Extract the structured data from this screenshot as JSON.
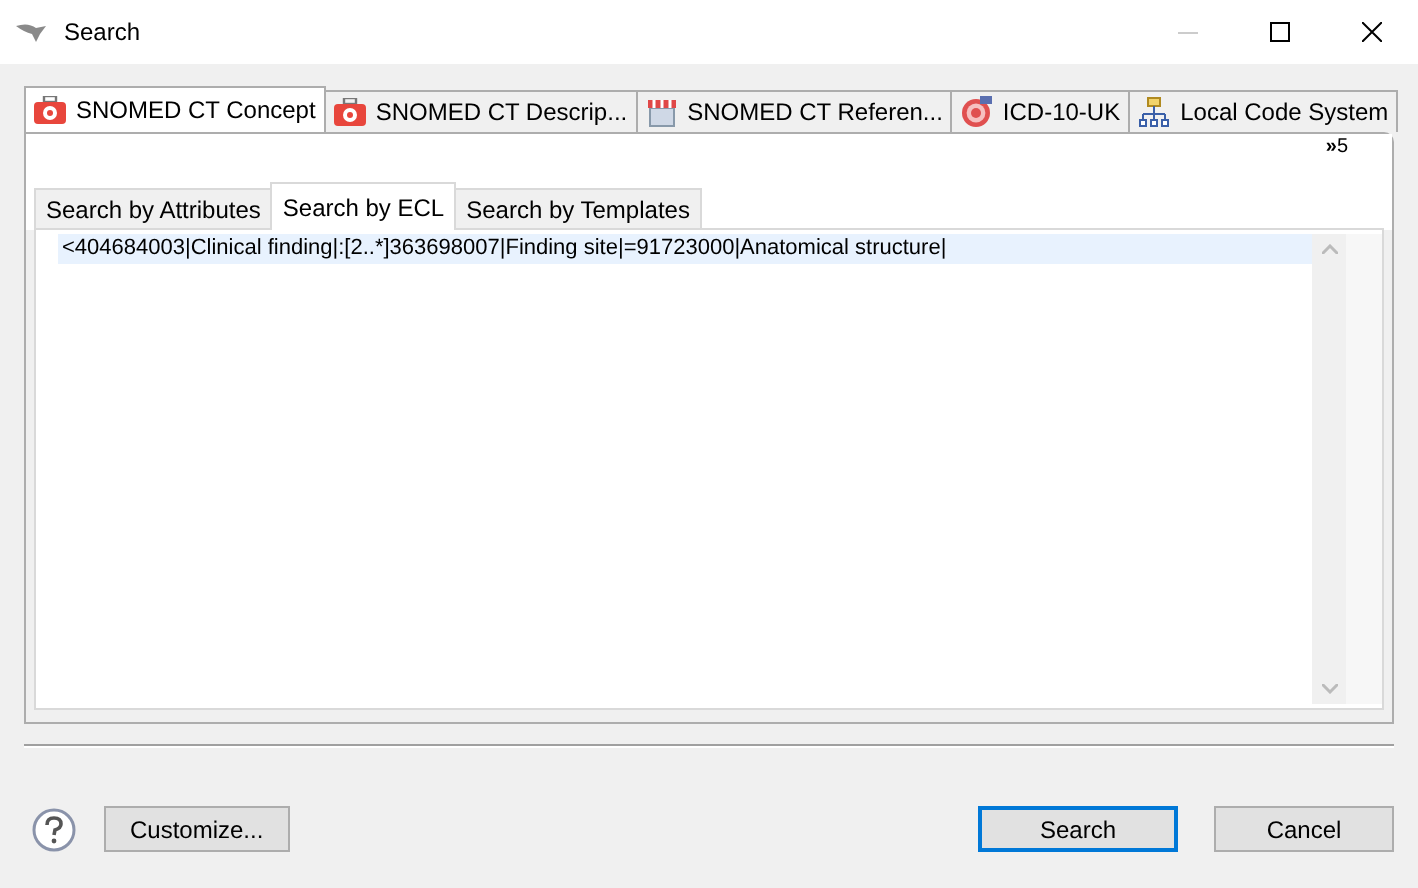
{
  "window": {
    "title": "Search"
  },
  "tabs": [
    {
      "label": "SNOMED CT Concept",
      "kind": "kit",
      "selected": true
    },
    {
      "label": "SNOMED CT Descrip...",
      "kind": "kit",
      "selected": false
    },
    {
      "label": "SNOMED CT Referen...",
      "kind": "shop",
      "selected": false
    },
    {
      "label": "ICD-10-UK",
      "kind": "target",
      "selected": false
    },
    {
      "label": "Local Code System",
      "kind": "tree",
      "selected": false
    }
  ],
  "overflow": {
    "icon": "»",
    "count": "5"
  },
  "subtabs": [
    {
      "label": "Search by Attributes",
      "selected": false
    },
    {
      "label": "Search by ECL",
      "selected": true
    },
    {
      "label": "Search by Templates",
      "selected": false
    }
  ],
  "editor": {
    "value": "<404684003|Clinical finding|:[2..*]363698007|Finding site|=91723000|Anatomical structure|"
  },
  "buttons": [
    {
      "label": "Customize...",
      "default": false
    },
    {
      "label": "Search",
      "default": true
    },
    {
      "label": "Cancel",
      "default": false
    }
  ]
}
